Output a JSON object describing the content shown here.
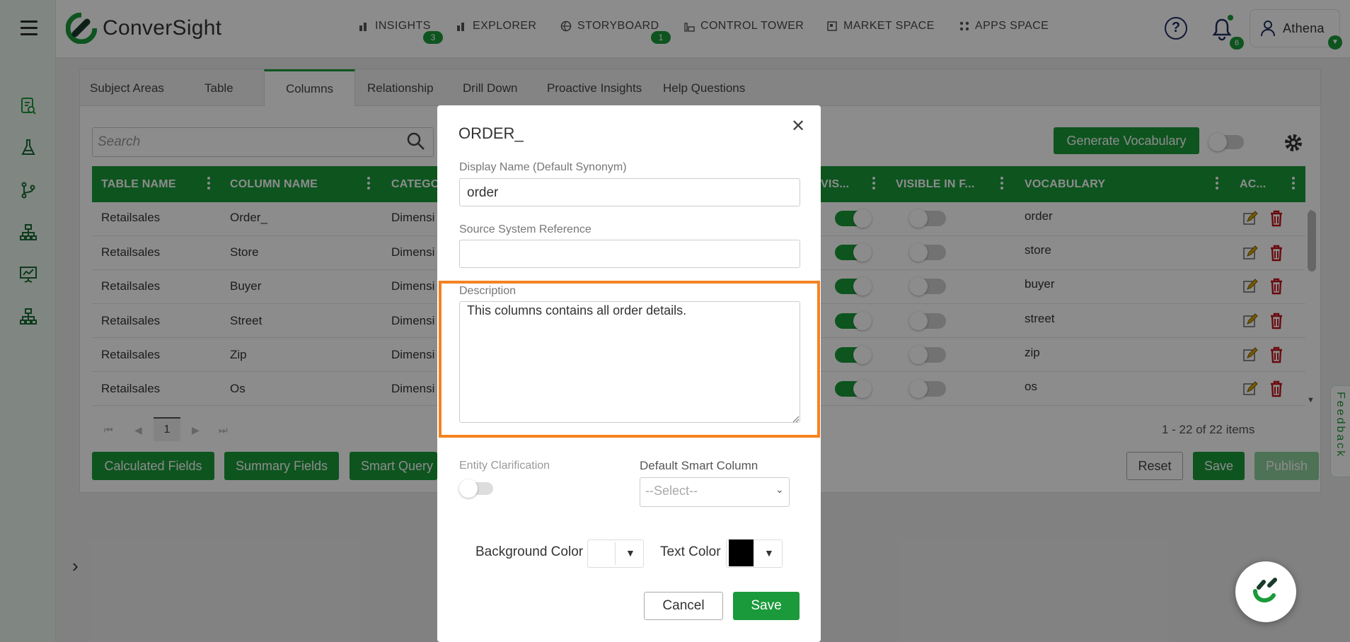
{
  "app": {
    "name": "ConverSight"
  },
  "nav": [
    {
      "label": "INSIGHTS",
      "badge": "3",
      "icon": "bar-chart-icon"
    },
    {
      "label": "EXPLORER",
      "badge": "",
      "icon": "bar-chart-icon"
    },
    {
      "label": "STORYBOARD",
      "badge": "1",
      "icon": "globe-icon"
    },
    {
      "label": "CONTROL TOWER",
      "badge": "",
      "icon": "tower-icon"
    },
    {
      "label": "MARKET SPACE",
      "badge": "",
      "icon": "market-icon"
    },
    {
      "label": "APPS SPACE",
      "badge": "",
      "icon": "apps-grid-icon"
    }
  ],
  "header": {
    "notifications": "6",
    "user": "Athena",
    "help": "?"
  },
  "rail_icons": [
    "document-search-icon",
    "flask-icon",
    "git-branch-icon",
    "hierarchy-icon",
    "presentation-chart-icon",
    "hierarchy-icon"
  ],
  "tabs": [
    "Subject Areas",
    "Table",
    "Columns",
    "Relationship",
    "Drill Down",
    "Proactive Insights",
    "Help Questions"
  ],
  "active_tab": "Columns",
  "search": {
    "placeholder": "Search"
  },
  "toolbar": {
    "generate_vocabulary": "Generate Vocabulary"
  },
  "table": {
    "headers": [
      "TABLE NAME",
      "COLUMN NAME",
      "CATEGO",
      "VIS...",
      "VISIBLE IN F...",
      "VOCABULARY",
      "AC..."
    ],
    "rows": [
      {
        "table": "Retailsales",
        "column": "Order_",
        "category": "Dimensi",
        "visible": true,
        "visible_in_f": false,
        "vocabulary": "order"
      },
      {
        "table": "Retailsales",
        "column": "Store",
        "category": "Dimensi",
        "visible": true,
        "visible_in_f": false,
        "vocabulary": "store"
      },
      {
        "table": "Retailsales",
        "column": "Buyer",
        "category": "Dimensi",
        "visible": true,
        "visible_in_f": false,
        "vocabulary": "buyer"
      },
      {
        "table": "Retailsales",
        "column": "Street",
        "category": "Dimensi",
        "visible": true,
        "visible_in_f": false,
        "vocabulary": "street"
      },
      {
        "table": "Retailsales",
        "column": "Zip",
        "category": "Dimensi",
        "visible": true,
        "visible_in_f": false,
        "vocabulary": "zip"
      },
      {
        "table": "Retailsales",
        "column": "Os",
        "category": "Dimensi",
        "visible": true,
        "visible_in_f": false,
        "vocabulary": "os"
      }
    ]
  },
  "pager": {
    "current": "1",
    "summary": "1 - 22 of 22 items"
  },
  "bottom_buttons": {
    "calculated": "Calculated Fields",
    "summary": "Summary Fields",
    "smart_query": "Smart Query",
    "reset": "Reset",
    "save": "Save",
    "publish": "Publish"
  },
  "feedback": "Feedback",
  "modal": {
    "title": "ORDER_",
    "display_name_label": "Display Name (Default Synonym)",
    "display_name_value": "order",
    "source_ref_label": "Source System Reference",
    "source_ref_value": "",
    "description_label": "Description",
    "description_value": "This columns contains all order details.",
    "entity_label": "Entity Clarification",
    "entity_on": false,
    "smart_column_label": "Default Smart Column",
    "smart_column_value": "--Select--",
    "bg_color_label": "Background Color",
    "bg_color": "#ffffff",
    "text_color_label": "Text Color",
    "text_color": "#000000",
    "cancel": "Cancel",
    "save": "Save"
  },
  "colors": {
    "brand_green": "#1a9a3a",
    "highlight": "#f58220"
  }
}
